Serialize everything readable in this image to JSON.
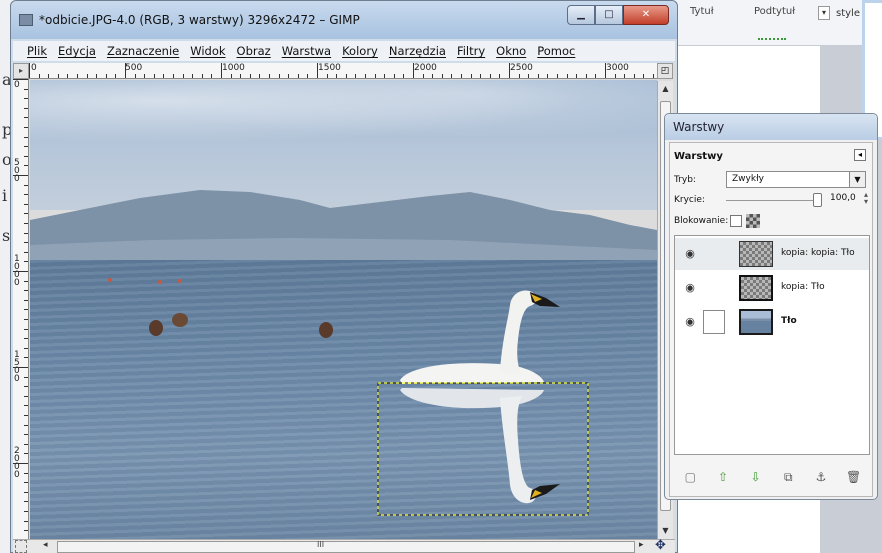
{
  "background_app": {
    "ribbon": {
      "item1": "Tytuł",
      "item2": "Podtytuł",
      "item3": "style"
    },
    "left_chars": [
      "a",
      "p",
      "o",
      "i",
      "s"
    ]
  },
  "gimp_window": {
    "title": "*odbicie.JPG-4.0 (RGB, 3 warstwy) 3296x2472 – GIMP",
    "menu": [
      "Plik",
      "Edycja",
      "Zaznaczenie",
      "Widok",
      "Obraz",
      "Warstwa",
      "Kolory",
      "Narzędzia",
      "Filtry",
      "Okno",
      "Pomoc"
    ],
    "ruler_h": [
      "0",
      "500",
      "1000",
      "1500",
      "2000",
      "2500",
      "3000"
    ],
    "ruler_v": [
      "0",
      "500",
      "1000",
      "1500",
      "2000"
    ],
    "scrollbar_mid": "III"
  },
  "layers_dock": {
    "window_title": "Warstwy",
    "pane_title": "Warstwy",
    "mode_label": "Tryb:",
    "mode_value": "Zwykły",
    "opacity_label": "Krycie:",
    "opacity_value": "100,0",
    "opacity_fraction": 1.0,
    "lock_label": "Blokowanie:",
    "layers": [
      {
        "name": "kopia: kopia: Tło",
        "thumbnail": "checker",
        "visible": true,
        "selected": true
      },
      {
        "name": "kopia: Tło",
        "thumbnail": "checker",
        "visible": true,
        "selected": false
      },
      {
        "name": "Tło",
        "thumbnail": "photo",
        "visible": true,
        "selected": false
      }
    ],
    "toolbar_icons": [
      "new-layer-icon",
      "raise-layer-icon",
      "lower-layer-icon",
      "duplicate-layer-icon",
      "anchor-layer-icon",
      "delete-layer-icon"
    ]
  },
  "colors": {
    "selection": "#ffff00",
    "titlebar": "#b9cde4",
    "close_button": "#c3402a"
  }
}
